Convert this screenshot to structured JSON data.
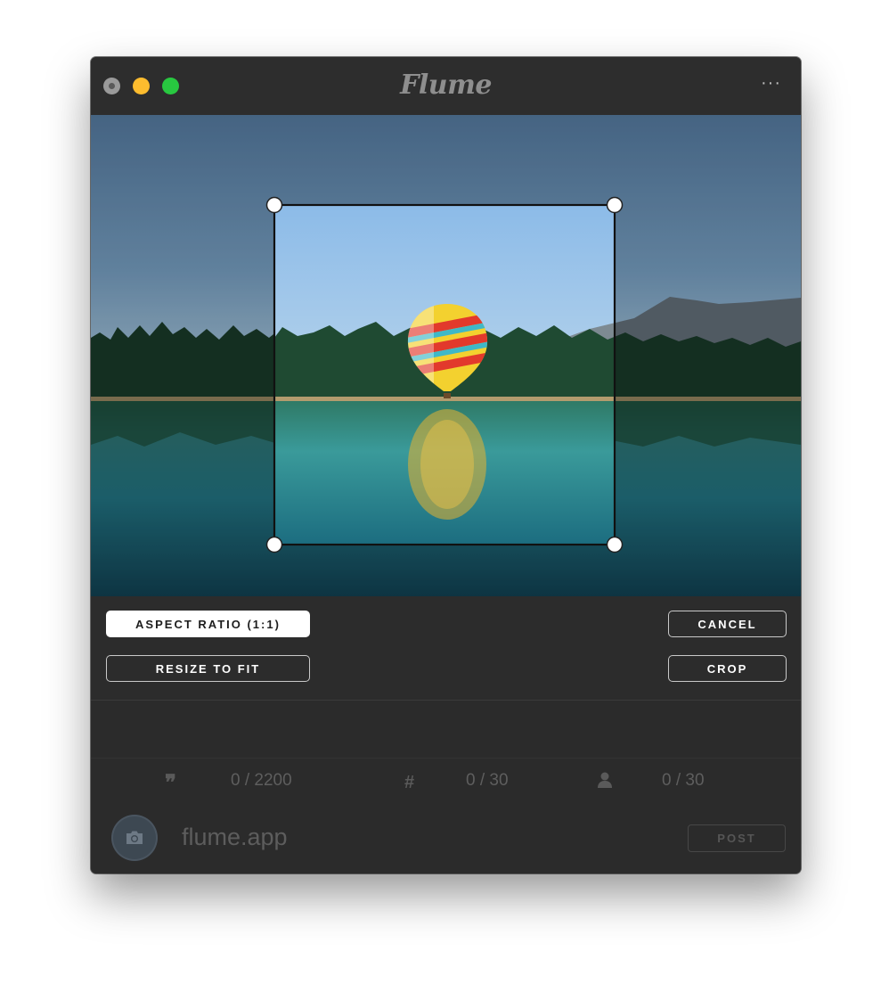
{
  "window": {
    "app_name": "Flume",
    "more_menu": "···",
    "traffic_lights": [
      "close",
      "minimize",
      "zoom"
    ]
  },
  "crop_tools": {
    "aspect_ratio_label": "ASPECT RATIO (1:1)",
    "resize_label": "RESIZE TO FIT",
    "cancel_label": "CANCEL",
    "crop_label": "CROP"
  },
  "counters": {
    "caption": {
      "icon": "quote-icon",
      "value": "0 / 2200"
    },
    "hashtags": {
      "icon": "hashtag-icon",
      "value": "0 / 30"
    },
    "mentions": {
      "icon": "person-icon",
      "value": "0 / 30"
    }
  },
  "footer": {
    "account": "flume.app",
    "post_label": "POST"
  },
  "colors": {
    "window_bg": "#2b2b2b",
    "close": "#9a9a9a",
    "minimize": "#fdbc2e",
    "zoom": "#28c840"
  }
}
